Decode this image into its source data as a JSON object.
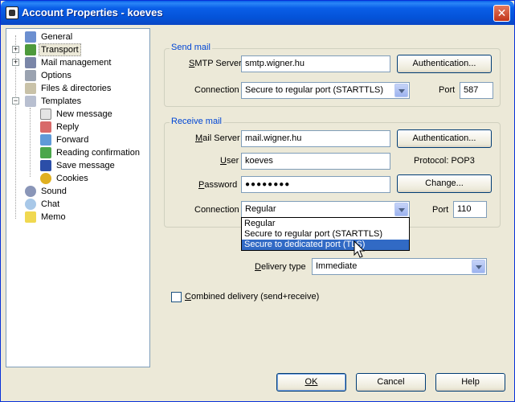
{
  "window": {
    "title": "Account Properties - koeves",
    "close_glyph": "✕"
  },
  "tree": {
    "items": [
      {
        "label": "General",
        "icon": "person-icon"
      },
      {
        "label": "Transport",
        "icon": "network-icon"
      },
      {
        "label": "Mail management",
        "icon": "mailbox-icon"
      },
      {
        "label": "Options",
        "icon": "options-icon"
      },
      {
        "label": "Files & directories",
        "icon": "folder-icon"
      },
      {
        "label": "Templates",
        "icon": "templates-icon"
      },
      {
        "label": "New message",
        "icon": "document-icon"
      },
      {
        "label": "Reply",
        "icon": "reply-icon"
      },
      {
        "label": "Forward",
        "icon": "forward-icon"
      },
      {
        "label": "Reading confirmation",
        "icon": "confirmation-icon"
      },
      {
        "label": "Save message",
        "icon": "save-icon"
      },
      {
        "label": "Cookies",
        "icon": "cookies-icon"
      },
      {
        "label": "Sound",
        "icon": "speaker-icon"
      },
      {
        "label": "Chat",
        "icon": "chat-icon"
      },
      {
        "label": "Memo",
        "icon": "memo-icon"
      }
    ],
    "selected": "Transport"
  },
  "send_mail": {
    "title": "Send mail",
    "smtp_label_pre": "S",
    "smtp_label_rest": "MTP Server",
    "smtp_value": "smtp.wigner.hu",
    "auth_button": "Authentication...",
    "connection_label": "Connection",
    "connection_value": "Secure to regular port (STARTTLS)",
    "port_label": "Port",
    "port_value": "587"
  },
  "receive_mail": {
    "title": "Receive mail",
    "server_label_pre": "M",
    "server_label_rest": "ail Server",
    "server_value": "mail.wigner.hu",
    "auth_button": "Authentication...",
    "user_label_pre": "U",
    "user_label_rest": "ser",
    "user_value": "koeves",
    "protocol_text": "Protocol:  POP3",
    "password_label_pre": "P",
    "password_label_rest": "assword",
    "password_value": "●●●●●●●●",
    "change_button": "Change...",
    "connection_label": "Connection",
    "connection_value": "Regular",
    "port_label": "Port",
    "port_value": "110",
    "dropdown_options": [
      "Regular",
      "Secure to regular port (STARTTLS)",
      "Secure to dedicated port (TLS)"
    ],
    "dropdown_highlighted_index": 2
  },
  "delivery": {
    "label_pre": "D",
    "label_rest": "elivery type",
    "value": "Immediate"
  },
  "combined": {
    "label_pre": "C",
    "label_rest": "ombined delivery (send+receive)",
    "checked": false
  },
  "buttons": {
    "ok": "OK",
    "cancel": "Cancel",
    "help": "Help"
  },
  "colors": {
    "titlebar": "#0453d8",
    "group_title": "#0046d5",
    "selection": "#316ac5"
  }
}
